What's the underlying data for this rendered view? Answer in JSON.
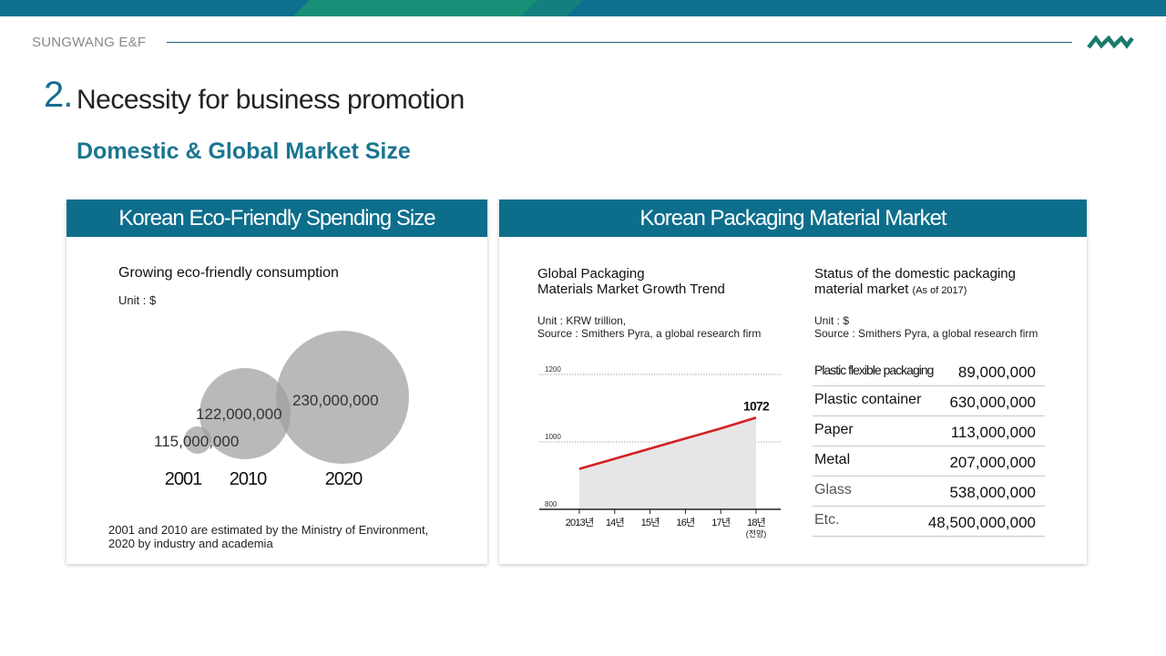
{
  "header": {
    "brand": "SUNGWANG E&F",
    "section_number": "2.",
    "title": "Necessity for business promotion",
    "subtitle": "Domestic & Global Market Size",
    "colors": {
      "primary": "#0d6e8c",
      "accent_green": "#1a8a6a"
    }
  },
  "left_panel": {
    "heading": "Korean Eco-Friendly Spending Size",
    "chart_title": "Growing eco-friendly consumption",
    "unit": "Unit : $",
    "note_line1": "2001 and 2010 are estimated by the Ministry of Environment,",
    "note_line2": "2020 by industry and academia"
  },
  "right_panel": {
    "heading": "Korean Packaging Material Market",
    "trend_title_line1": "Global Packaging",
    "trend_title_line2": "Materials Market Growth Trend",
    "trend_unit": "Unit : KRW trillion,",
    "trend_source": "Source : Smithers Pyra, a global research firm",
    "status_title_line1": "Status of the domestic packaging",
    "status_title_line2": "material market",
    "status_asof": "(As of 2017)",
    "status_unit": "Unit : $",
    "status_source": "Source : Smithers Pyra, a global research firm"
  },
  "chart_data": [
    {
      "type": "bubble",
      "title": "Growing eco-friendly consumption",
      "unit": "$",
      "categories": [
        "2001",
        "2010",
        "2020"
      ],
      "values": [
        115000000,
        122000000,
        230000000
      ],
      "value_labels": [
        "115,000,000",
        "122,000,000",
        "230,000,000"
      ]
    },
    {
      "type": "line",
      "title": "Global Packaging Materials Market Growth Trend",
      "categories": [
        "2013년",
        "14년",
        "15년",
        "16년",
        "17년",
        "18년"
      ],
      "category_sub": [
        "",
        "",
        "",
        "",
        "",
        "(전망)"
      ],
      "values": [
        920,
        950,
        980,
        1010,
        1040,
        1072
      ],
      "end_label": "1072",
      "ylim": [
        800,
        1200
      ],
      "yticks": [
        "1200",
        "1000",
        "800"
      ],
      "line_color": "#d42020"
    },
    {
      "type": "table",
      "title": "Status of the domestic packaging material market",
      "rows": [
        {
          "label": "Plastic flexible packaging",
          "value": "89,000,000"
        },
        {
          "label": "Plastic container",
          "value": "630,000,000"
        },
        {
          "label": "Paper",
          "value": "113,000,000"
        },
        {
          "label": "Metal",
          "value": "207,000,000"
        },
        {
          "label": "Glass",
          "value": "538,000,000"
        },
        {
          "label": "Etc.",
          "value": "48,500,000,000"
        }
      ]
    }
  ]
}
